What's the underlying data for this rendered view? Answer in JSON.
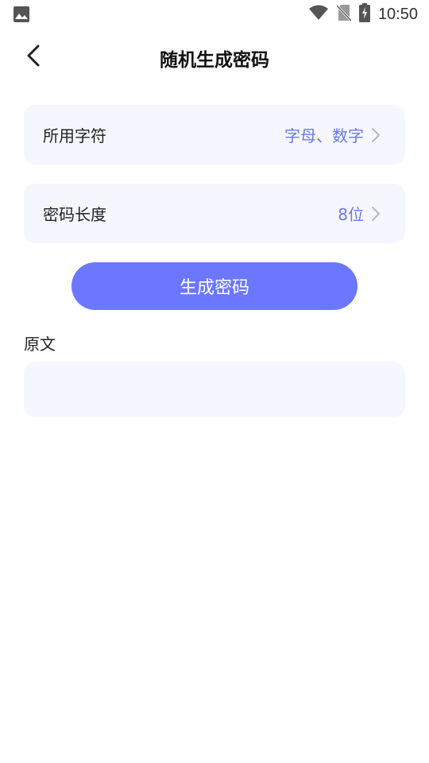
{
  "status_bar": {
    "time": "10:50",
    "icons": [
      "image-icon",
      "wifi-icon",
      "no-sim-icon",
      "battery-charging-icon"
    ]
  },
  "app_bar": {
    "title": "随机生成密码",
    "back_icon": "chevron-left-icon"
  },
  "settings": [
    {
      "label": "所用字符",
      "value": "字母、数字"
    },
    {
      "label": "密码长度",
      "value": "8位"
    }
  ],
  "generate_button": {
    "label": "生成密码"
  },
  "output": {
    "label": "原文",
    "value": ""
  },
  "colors": {
    "accent": "#6b77ff",
    "card_bg": "#f6f7fe",
    "value_text": "#6b77ee"
  }
}
